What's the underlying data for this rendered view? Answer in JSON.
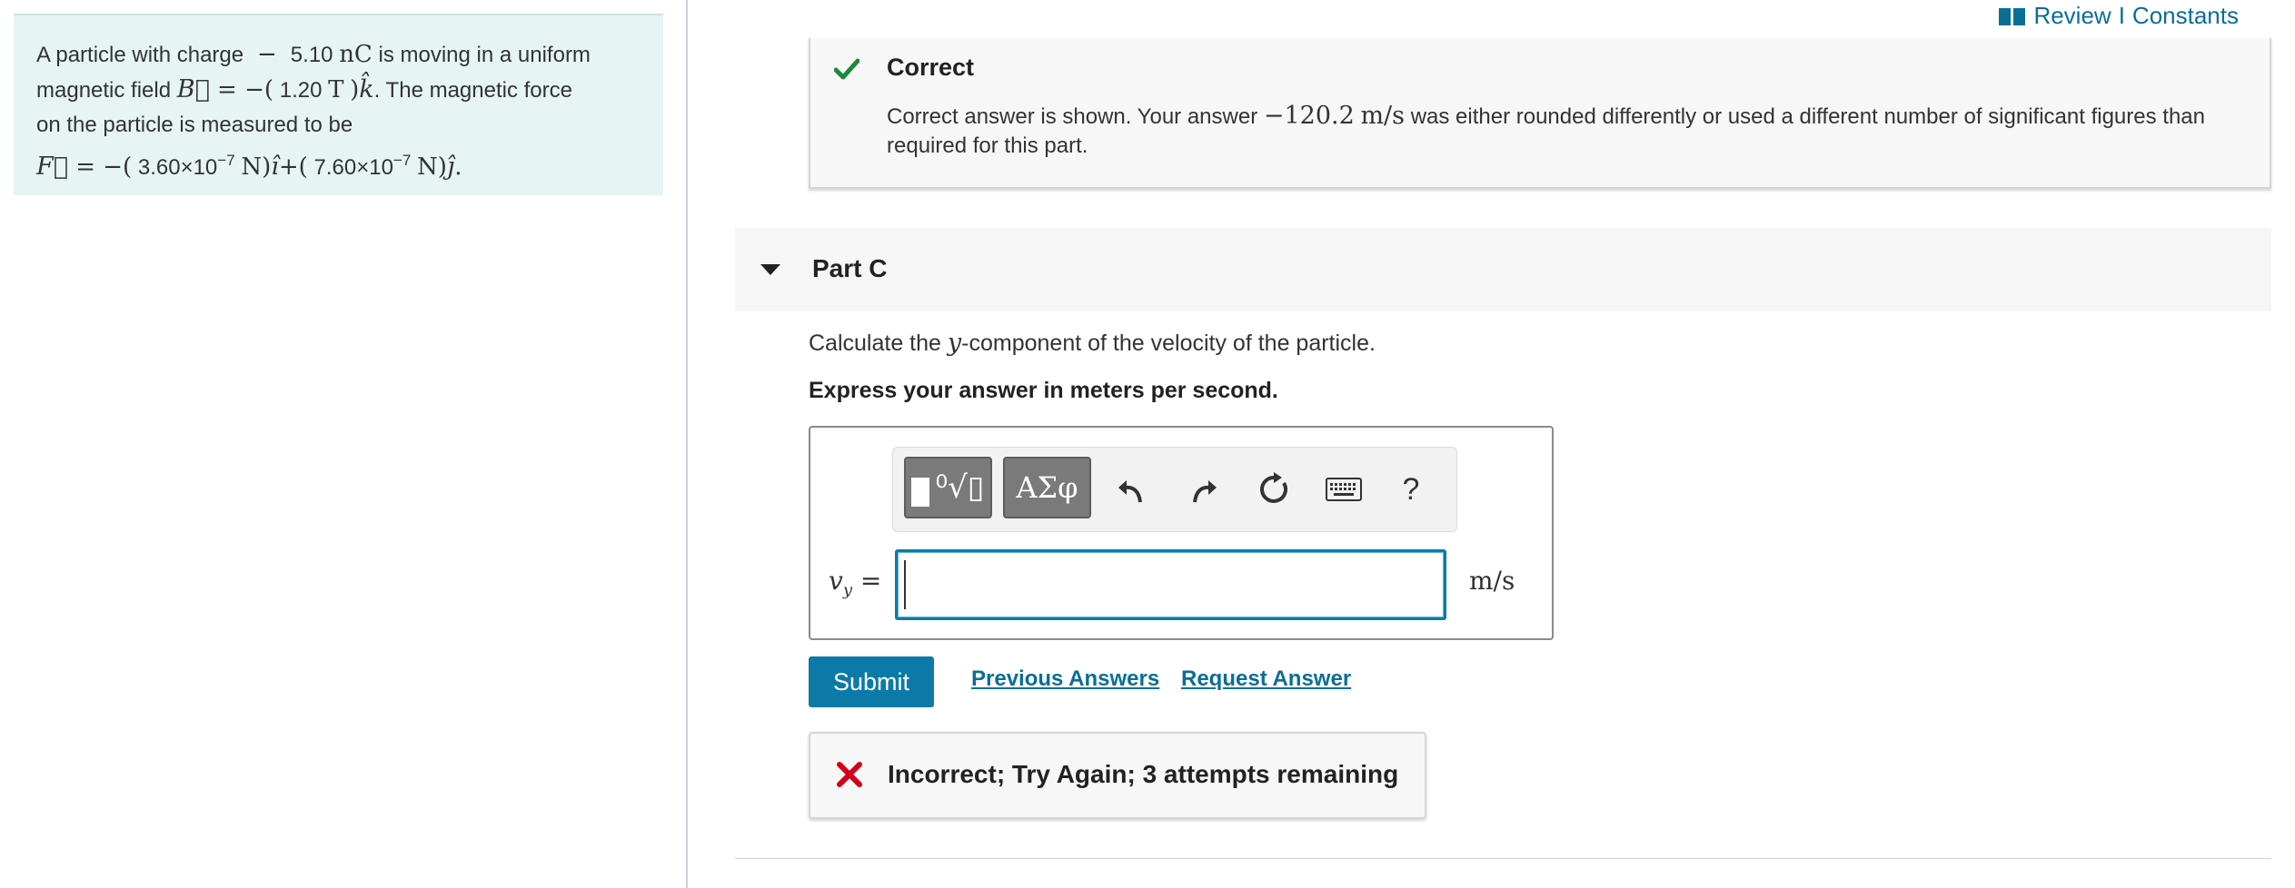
{
  "header": {
    "review_label": "Review",
    "separator": "I",
    "constants_label": "Constants"
  },
  "problem": {
    "line1_pre": "A particle with charge",
    "charge_value": "5.10",
    "charge_unit": "nC",
    "line1_post": "is moving in a uniform",
    "line2_pre": "magnetic field",
    "field_value": "1.20",
    "field_unit": "T",
    "line2_post": ". The magnetic force",
    "line3": "on the particle is measured to be",
    "force_x_value": "3.60×10",
    "force_x_exp": "−7",
    "force_y_value": "7.60×10",
    "force_y_exp": "−7",
    "force_unit": "N"
  },
  "correct_feedback": {
    "title": "Correct",
    "body_pre": "Correct answer is shown. Your answer",
    "answer_value": "−120.2",
    "answer_unit": "m/s",
    "body_post": "was either rounded differently or used a different number of significant figures than required for this part.",
    "icon": "checkmark-icon",
    "color": "#1b8a3a"
  },
  "part_c": {
    "title": "Part C",
    "question_pre": "Calculate the",
    "question_var": "y",
    "question_post": "-component of the velocity of the particle.",
    "instruction": "Express your answer in meters per second.",
    "toolbar": {
      "templates_icon": "templates-icon",
      "greek_label": "ΑΣφ",
      "undo_icon": "undo-icon",
      "redo_icon": "redo-icon",
      "reset_icon": "reset-icon",
      "keyboard_icon": "keyboard-icon",
      "help_label": "?"
    },
    "variable": "v",
    "variable_sub": "y",
    "equals": "=",
    "input_value": "",
    "unit": "m/s"
  },
  "actions": {
    "submit_label": "Submit",
    "previous_answers_label": "Previous Answers",
    "request_answer_label": "Request Answer"
  },
  "incorrect_feedback": {
    "text": "Incorrect; Try Again; 3 attempts remaining",
    "icon": "x-icon",
    "color": "#d0021b"
  },
  "colors": {
    "accent": "#0b7aa8",
    "link": "#0b6e96",
    "problem_bg": "#e6f4f4"
  }
}
